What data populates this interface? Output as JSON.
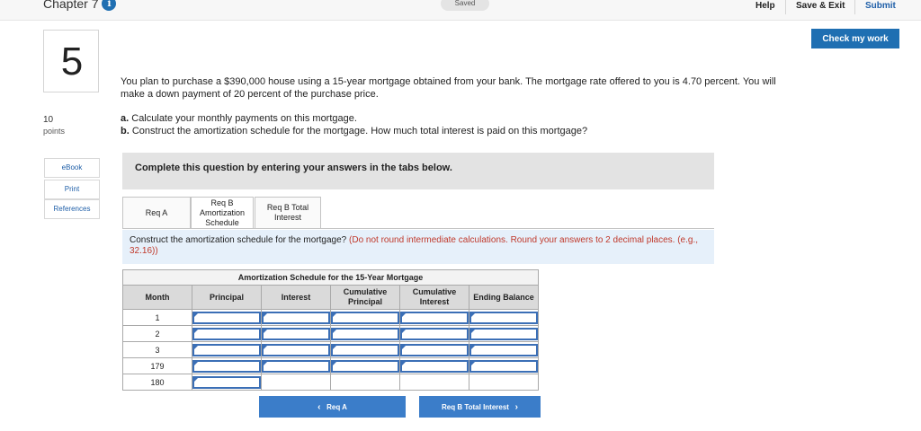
{
  "header": {
    "chapter": "Chapter 7",
    "info_icon": "info-icon",
    "saved": "Saved",
    "help": "Help",
    "save_exit": "Save & Exit",
    "submit": "Submit",
    "check_my_work": "Check my work"
  },
  "question": {
    "number": "5",
    "points_value": "10",
    "points_label": "points",
    "text": "You plan to purchase a $390,000 house using a 15-year mortgage obtained from your bank. The mortgage rate offered to you is 4.70 percent. You will make a down payment of 20 percent of the purchase price.",
    "part_a_label": "a.",
    "part_a": "Calculate your monthly payments on this mortgage.",
    "part_b_label": "b.",
    "part_b": "Construct the amortization schedule for the mortgage. How much total interest is paid on this mortgage?"
  },
  "sidebar": {
    "items": [
      {
        "label": "eBook"
      },
      {
        "label": "Print"
      },
      {
        "label": "References"
      }
    ]
  },
  "panel": {
    "complete_text": "Complete this question by entering your answers in the tabs below.",
    "tabs": [
      {
        "label": "Req A"
      },
      {
        "label": "Req B Amortization Schedule"
      },
      {
        "label": "Req B Total Interest"
      }
    ],
    "instruction_main": "Construct the amortization schedule for the mortgage?",
    "instruction_note": "(Do not round intermediate calculations. Round your answers to 2 decimal places. (e.g., 32.16))"
  },
  "table": {
    "caption": "Amortization Schedule for the 15-Year Mortgage",
    "columns": [
      "Month",
      "Principal",
      "Interest",
      "Cumulative Principal",
      "Cumulative Interest",
      "Ending Balance"
    ],
    "months": [
      "1",
      "2",
      "3",
      "179",
      "180"
    ]
  },
  "nav": {
    "prev_label": "Req A",
    "next_label": "Req B Total Interest",
    "prev_icon": "chevron-left-icon",
    "next_icon": "chevron-right-icon"
  },
  "colors": {
    "accent": "#1f6fb2",
    "nav_button": "#3b7dc9",
    "instruction_bg": "#e6f0fa",
    "note_red": "#c0392b"
  }
}
